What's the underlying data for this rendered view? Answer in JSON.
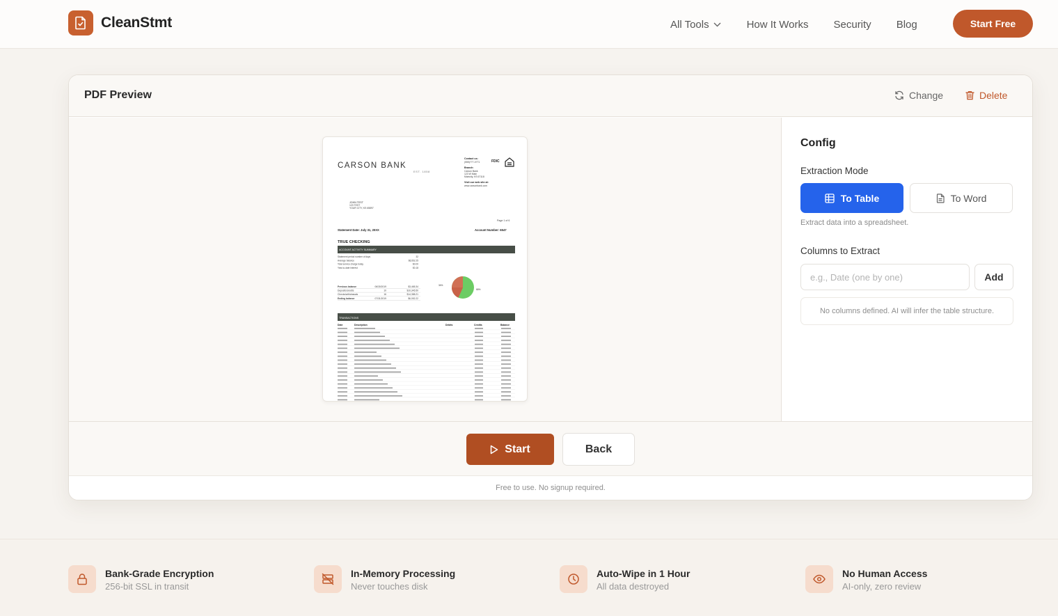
{
  "brand": {
    "name": "CleanStmt",
    "accent": "#c0582b",
    "primary_blue": "#2563eb"
  },
  "nav": {
    "items": [
      "All Tools",
      "How It Works",
      "Security",
      "Blog"
    ],
    "cta": "Start Free"
  },
  "card": {
    "title": "PDF Preview",
    "change_label": "Change",
    "delete_label": "Delete"
  },
  "document": {
    "bank_name": "CARSON BANK",
    "bank_est": "EST. 1858",
    "contact_label": "Contact us:",
    "contact_phone": "(555)777-0771",
    "branch_label": "Branch:",
    "branch_lines": [
      "Carson Bank",
      "123 W Main",
      "Maincity, KS 67118"
    ],
    "web_label": "Visit our web site at:",
    "web_url": "www.carsonbank.com",
    "fdic": "FDIC",
    "customer_lines": [
      "JOHN TEST",
      "123 TEST",
      "YOUR CITY, KS 65897"
    ],
    "page": "Page 1 of 6",
    "statement_date": "Statement Date: July 31, 20XX",
    "account_number": "Account Number: 6547",
    "account_type": "TRUE CHECKING",
    "summary_header": "ACCOUNT ACTIVITY SUMMARY",
    "summary_rows": [
      [
        "Statement period number of days",
        "32"
      ],
      [
        "Average balance",
        "$6,552.25"
      ],
      [
        "Total service charge today",
        "$0.00"
      ],
      [
        "Year-to-date interest",
        "$0.18"
      ]
    ],
    "balance_rows": [
      [
        "Previous balance",
        "06/30/2019",
        "$3,465.34"
      ],
      [
        "Deposits/credits",
        "10",
        "$10,345.50"
      ],
      [
        "Checks/withdrawals",
        "16",
        "$14,388.21"
      ],
      [
        "Ending balance",
        "07/31/2019",
        "$6,052.22"
      ]
    ],
    "pie_labels": [
      "34%",
      "66%"
    ],
    "transactions_header": "TRANSACTIONS",
    "transaction_columns": [
      "Date",
      "Description",
      "Debits",
      "Credits",
      "Balance"
    ]
  },
  "config": {
    "title": "Config",
    "extraction_mode_label": "Extraction Mode",
    "mode_table": "To Table",
    "mode_word": "To Word",
    "mode_helper": "Extract data into a spreadsheet.",
    "columns_label": "Columns to Extract",
    "columns_placeholder": "e.g., Date (one by one)",
    "add_label": "Add",
    "empty_hint": "No columns defined. AI will infer the table structure."
  },
  "actions": {
    "start_label": "Start",
    "back_label": "Back",
    "note": "Free to use. No signup required."
  },
  "trust": [
    {
      "icon": "lock-icon",
      "title": "Bank-Grade Encryption",
      "sub": "256-bit SSL in transit"
    },
    {
      "icon": "no-disk-icon",
      "title": "In-Memory Processing",
      "sub": "Never touches disk"
    },
    {
      "icon": "clock-icon",
      "title": "Auto-Wipe in 1 Hour",
      "sub": "All data destroyed"
    },
    {
      "icon": "eye-icon",
      "title": "No Human Access",
      "sub": "AI-only, zero review"
    }
  ]
}
